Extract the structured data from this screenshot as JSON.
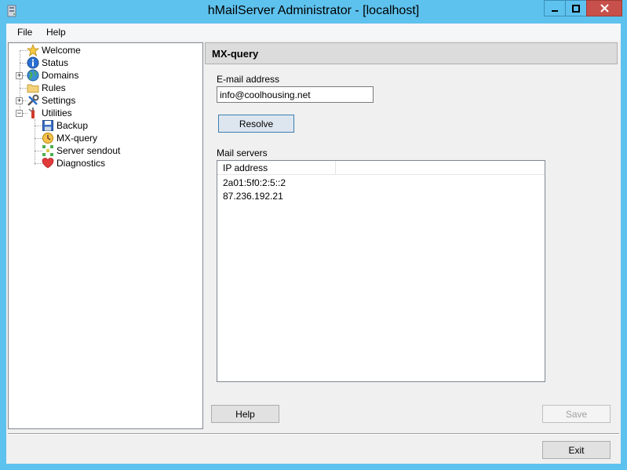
{
  "window": {
    "title": "hMailServer Administrator - [localhost]",
    "icon": "server-app-icon"
  },
  "menu": {
    "file": "File",
    "help": "Help"
  },
  "tree": {
    "items": [
      {
        "label": "Welcome",
        "icon": "star-icon"
      },
      {
        "label": "Status",
        "icon": "info-icon"
      },
      {
        "label": "Domains",
        "icon": "globe-icon"
      },
      {
        "label": "Rules",
        "icon": "folder-icon"
      },
      {
        "label": "Settings",
        "icon": "tools-icon"
      },
      {
        "label": "Utilities",
        "icon": "utilities-icon"
      },
      {
        "label": "Backup",
        "icon": "floppy-icon"
      },
      {
        "label": "MX-query",
        "icon": "mx-query-icon"
      },
      {
        "label": "Server sendout",
        "icon": "sendout-icon"
      },
      {
        "label": "Diagnostics",
        "icon": "heart-icon"
      }
    ]
  },
  "panel": {
    "title": "MX-query",
    "email_label": "E-mail address",
    "email_value": "info@coolhousing.net",
    "resolve_label": "Resolve",
    "mail_servers_label": "Mail servers",
    "column_header": "IP address",
    "rows": [
      "2a01:5f0:2:5::2",
      "87.236.192.21"
    ],
    "help_label": "Help",
    "save_label": "Save"
  },
  "footer": {
    "exit_label": "Exit"
  },
  "colors": {
    "titlebar": "#5ec2ee",
    "close": "#c7504a",
    "face": "#f0f0f0"
  }
}
